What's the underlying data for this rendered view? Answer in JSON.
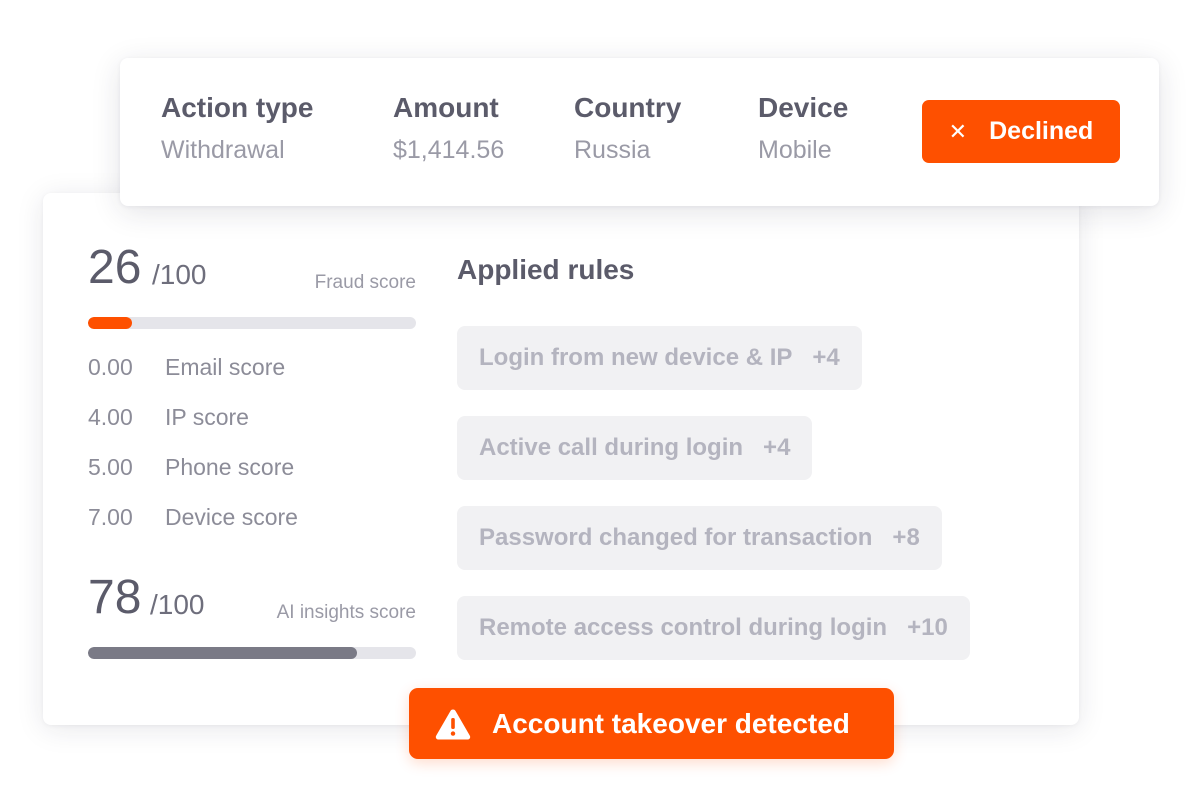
{
  "transaction": {
    "columns": [
      {
        "label": "Action type",
        "value": "Withdrawal"
      },
      {
        "label": "Amount",
        "value": "$1,414.56"
      },
      {
        "label": "Country",
        "value": "Russia"
      },
      {
        "label": "Device",
        "value": "Mobile"
      }
    ],
    "status": {
      "label": "Declined",
      "icon": "close-icon",
      "color": "#fe5000"
    }
  },
  "fraud_score": {
    "value": "26",
    "max": "/100",
    "label": "Fraud score",
    "fraction": 0.135,
    "color": "#fe5000"
  },
  "sub_scores": [
    {
      "value": "0.00",
      "label": "Email score"
    },
    {
      "value": "4.00",
      "label": "IP score"
    },
    {
      "value": "5.00",
      "label": "Phone score"
    },
    {
      "value": "7.00",
      "label": "Device score"
    }
  ],
  "ai_score": {
    "value": "78",
    "max": "/100",
    "label": "AI insights score",
    "fraction": 0.82,
    "color": "#7a7a86"
  },
  "applied_rules": {
    "title": "Applied rules",
    "items": [
      {
        "label": "Login from new device & IP",
        "points": "+4"
      },
      {
        "label": "Active call during login",
        "points": "+4"
      },
      {
        "label": "Password changed for transaction",
        "points": "+8"
      },
      {
        "label": "Remote access control during login",
        "points": "+10"
      }
    ]
  },
  "alert": {
    "label": "Account takeover detected",
    "icon": "warning-icon",
    "color": "#fe5000"
  }
}
